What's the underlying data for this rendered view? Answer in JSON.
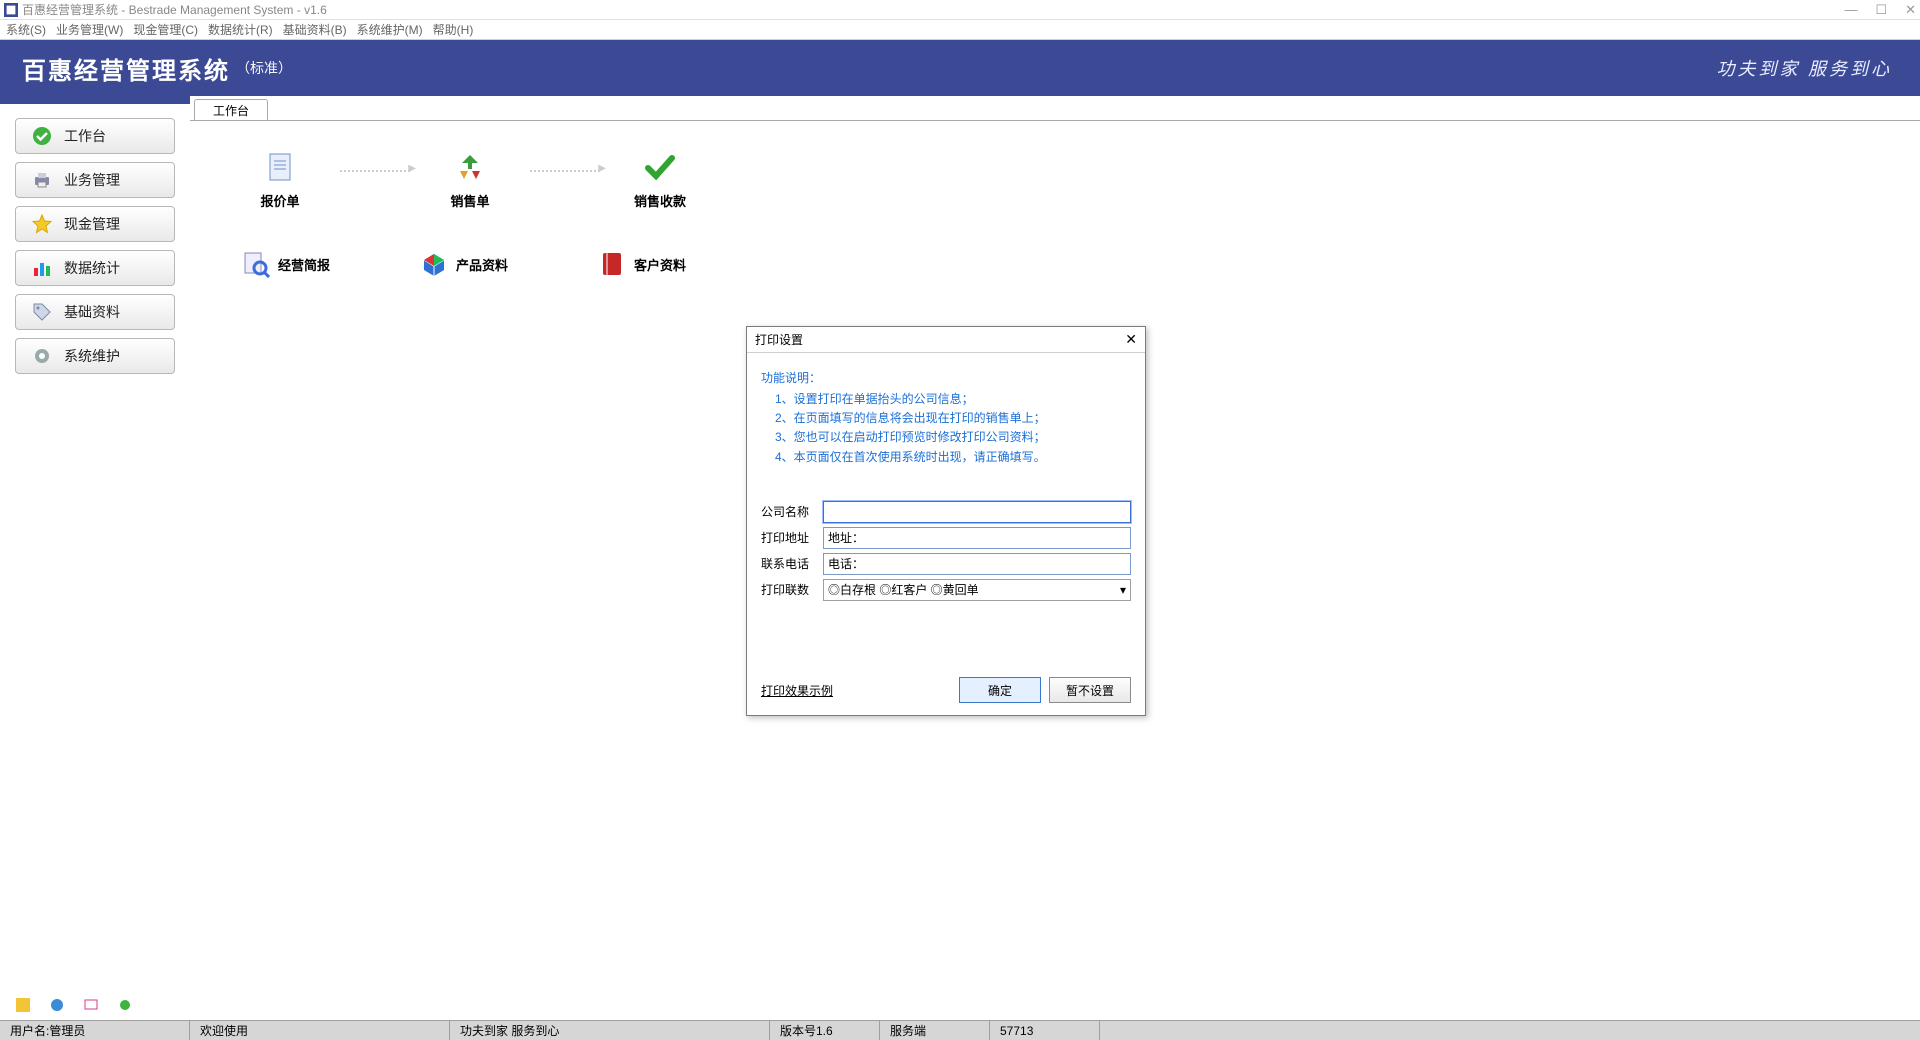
{
  "window": {
    "title": "百惠经营管理系统 - Bestrade Management System - v1.6",
    "controls": {
      "min": "—",
      "max": "☐",
      "close": "✕"
    }
  },
  "menu": [
    "系统(S)",
    "业务管理(W)",
    "现金管理(C)",
    "数据统计(R)",
    "基础资料(B)",
    "系统维护(M)",
    "帮助(H)"
  ],
  "banner": {
    "name": "百惠经营管理系统",
    "suffix": "（标准）",
    "slogan": "功夫到家 服务到心"
  },
  "sidebar": [
    {
      "label": "工作台",
      "icon": "ok-circle"
    },
    {
      "label": "业务管理",
      "icon": "printer"
    },
    {
      "label": "现金管理",
      "icon": "star"
    },
    {
      "label": "数据统计",
      "icon": "bars"
    },
    {
      "label": "基础资料",
      "icon": "tag"
    },
    {
      "label": "系统维护",
      "icon": "gear"
    }
  ],
  "tab": "工作台",
  "flow": [
    {
      "label": "报价单"
    },
    {
      "label": "销售单"
    },
    {
      "label": "销售收款"
    }
  ],
  "quick": [
    {
      "label": "经营简报"
    },
    {
      "label": "产品资料"
    },
    {
      "label": "客户资料"
    }
  ],
  "dialog": {
    "title": "打印设置",
    "desc_title": "功能说明：",
    "desc": [
      "1、设置打印在单据抬头的公司信息；",
      "2、在页面填写的信息将会出现在打印的销售单上；",
      "3、您也可以在启动打印预览时修改打印公司资料；",
      "4、本页面仅在首次使用系统时出现，请正确填写。"
    ],
    "fields": {
      "company_label": "公司名称",
      "company_value": "",
      "address_label": "打印地址",
      "address_value": "地址：",
      "phone_label": "联系电话",
      "phone_value": "电话：",
      "copies_label": "打印联数",
      "copies_value": "◎白存根 ◎红客户 ◎黄回单"
    },
    "example_link": "打印效果示例",
    "ok": "确定",
    "cancel": "暂不设置"
  },
  "status": {
    "user": "用户名:管理员",
    "welcome": "欢迎使用",
    "slogan": "功夫到家 服务到心",
    "version": "版本号1.6",
    "server": "服务端",
    "port": "57713"
  }
}
